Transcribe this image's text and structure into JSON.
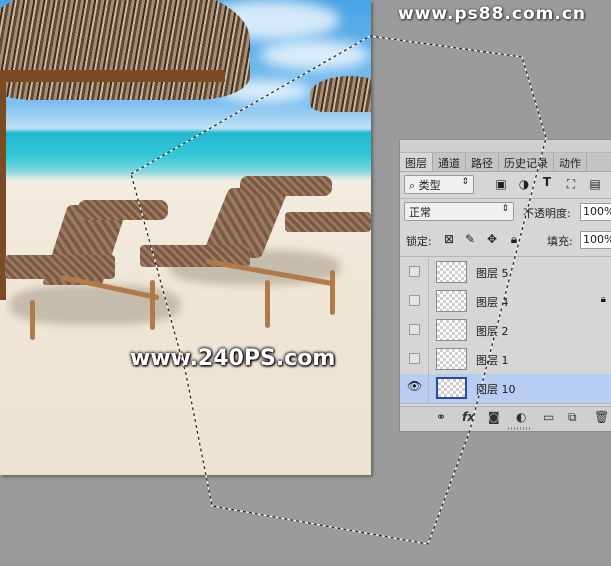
{
  "watermarks": {
    "site": "www.ps88.com.cn",
    "canvas": "www.240PS.com"
  },
  "panel": {
    "tabs": [
      "图层",
      "通道",
      "路径",
      "历史记录",
      "动作"
    ],
    "filter_kind": "类型",
    "blend_mode": "正常",
    "opacity_label": "不透明度:",
    "opacity_value": "100%",
    "lock_label": "锁定:",
    "fill_label": "填充:",
    "fill_value": "100%",
    "layers": [
      {
        "name": "图层 5",
        "visible": false,
        "locked": false,
        "selected": false
      },
      {
        "name": "图层 4",
        "visible": false,
        "locked": true,
        "selected": false
      },
      {
        "name": "图层 2",
        "visible": false,
        "locked": false,
        "selected": false
      },
      {
        "name": "图层 1",
        "visible": false,
        "locked": false,
        "selected": false
      },
      {
        "name": "图层 10",
        "visible": true,
        "locked": false,
        "selected": true
      }
    ]
  },
  "colors": {
    "workspace": "#9b9b9b",
    "selected_layer": "#b7cdf2"
  }
}
